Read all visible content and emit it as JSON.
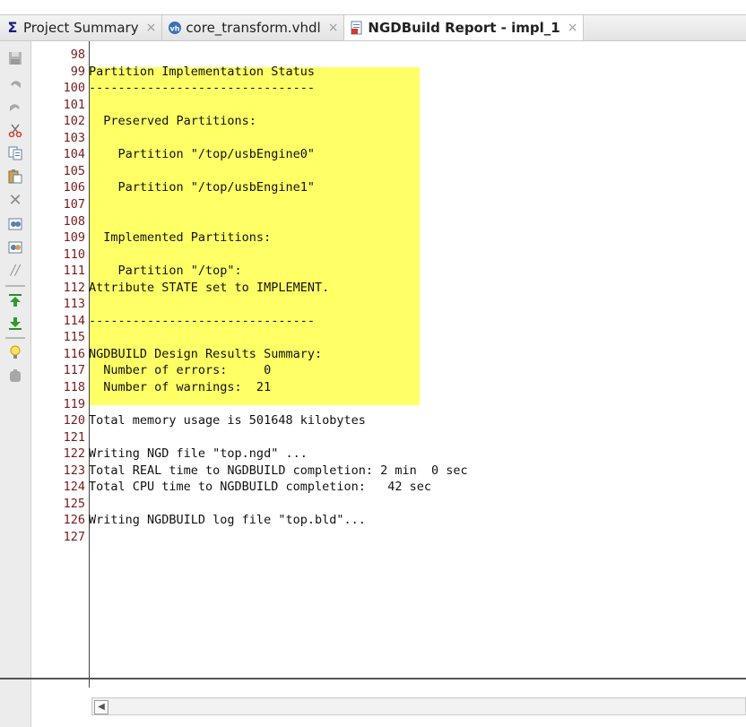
{
  "tabs": [
    {
      "label": "Project Summary",
      "icon": "sigma-icon",
      "active": false
    },
    {
      "label": "core_transform.vhdl",
      "icon": "vhdl-file-icon",
      "active": false
    },
    {
      "label": "NGDBuild Report - impl_1",
      "icon": "report-file-icon",
      "active": true
    }
  ],
  "tab_close_glyph": "×",
  "toolbar_icons": [
    "save-icon",
    "undo-icon",
    "redo-icon",
    "cut-icon",
    "copy-icon",
    "paste-icon",
    "delete-icon",
    "find-icon",
    "find-replace-icon",
    "comment-icon",
    "go-top-icon",
    "go-bottom-icon",
    "hint-icon",
    "settings-icon"
  ],
  "lines": [
    {
      "n": "98",
      "t": ""
    },
    {
      "n": "99",
      "t": "Partition Implementation Status"
    },
    {
      "n": "100",
      "t": "-------------------------------"
    },
    {
      "n": "101",
      "t": ""
    },
    {
      "n": "102",
      "t": "  Preserved Partitions:"
    },
    {
      "n": "103",
      "t": ""
    },
    {
      "n": "104",
      "t": "    Partition \"/top/usbEngine0\""
    },
    {
      "n": "105",
      "t": ""
    },
    {
      "n": "106",
      "t": "    Partition \"/top/usbEngine1\""
    },
    {
      "n": "107",
      "t": ""
    },
    {
      "n": "108",
      "t": ""
    },
    {
      "n": "109",
      "t": "  Implemented Partitions:"
    },
    {
      "n": "110",
      "t": ""
    },
    {
      "n": "111",
      "t": "    Partition \"/top\":"
    },
    {
      "n": "112",
      "t": "Attribute STATE set to IMPLEMENT."
    },
    {
      "n": "113",
      "t": ""
    },
    {
      "n": "114",
      "t": "-------------------------------"
    },
    {
      "n": "115",
      "t": ""
    },
    {
      "n": "116",
      "t": "NGDBUILD Design Results Summary:"
    },
    {
      "n": "117",
      "t": "  Number of errors:     0"
    },
    {
      "n": "118",
      "t": "  Number of warnings:  21"
    },
    {
      "n": "119",
      "t": ""
    },
    {
      "n": "120",
      "t": "Total memory usage is 501648 kilobytes"
    },
    {
      "n": "121",
      "t": ""
    },
    {
      "n": "122",
      "t": "Writing NGD file \"top.ngd\" ..."
    },
    {
      "n": "123",
      "t": "Total REAL time to NGDBUILD completion: 2 min  0 sec"
    },
    {
      "n": "124",
      "t": "Total CPU time to NGDBUILD completion:   42 sec"
    },
    {
      "n": "125",
      "t": ""
    },
    {
      "n": "126",
      "t": "Writing NGDBUILD log file \"top.bld\"..."
    },
    {
      "n": "127",
      "t": ""
    }
  ],
  "highlight_color": "#ffff66",
  "scroll_left_glyph": "◀"
}
